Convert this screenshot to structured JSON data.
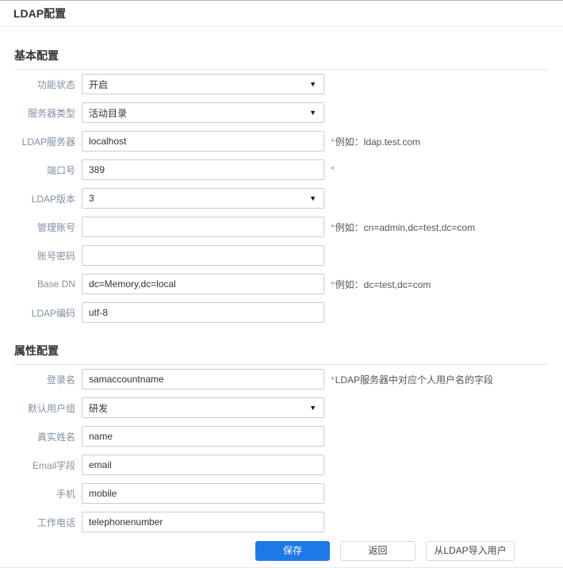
{
  "page": {
    "title": "LDAP配置"
  },
  "colors": {
    "accent_blue": "#1d79e8",
    "required_red": "#f56c6c",
    "label_gray_blue": "#8090a3",
    "border_gray": "#cccccc"
  },
  "icons": {
    "dropdown_arrow": "▼"
  },
  "sections": [
    {
      "title": "基本配置",
      "rows": [
        {
          "key": "function-status",
          "label": "功能状态",
          "type": "select",
          "value": "开启",
          "required": false,
          "hint": ""
        },
        {
          "key": "server-type",
          "label": "服务器类型",
          "type": "select",
          "value": "活动目录",
          "required": false,
          "hint": ""
        },
        {
          "key": "ldap-server",
          "label": "LDAP服务器",
          "type": "input",
          "value": "localhost",
          "required": true,
          "hint": "例如：ldap.test.com"
        },
        {
          "key": "port",
          "label": "端口号",
          "type": "input",
          "value": "389",
          "required": true,
          "hint": ""
        },
        {
          "key": "ldap-version",
          "label": "LDAP版本",
          "type": "select",
          "value": "3",
          "required": false,
          "hint": ""
        },
        {
          "key": "admin-account",
          "label": "管理账号",
          "type": "input",
          "value": "",
          "required": true,
          "hint": "例如：cn=admin,dc=test,dc=com"
        },
        {
          "key": "account-password",
          "label": "账号密码",
          "type": "input",
          "value": "",
          "required": false,
          "hint": ""
        },
        {
          "key": "base-dn",
          "label": "Base DN",
          "type": "input",
          "value": "dc=Memory,dc=local",
          "required": true,
          "hint": "例如：dc=test,dc=com"
        },
        {
          "key": "ldap-encoding",
          "label": "LDAP编码",
          "type": "input",
          "value": "utf-8",
          "required": false,
          "hint": ""
        }
      ]
    },
    {
      "title": "属性配置",
      "rows": [
        {
          "key": "login-name",
          "label": "登录名",
          "type": "input",
          "value": "samaccountname",
          "required": true,
          "hint": "LDAP服务器中对应个人用户名的字段"
        },
        {
          "key": "default-user-group",
          "label": "默认用户组",
          "type": "select",
          "value": "研发",
          "required": false,
          "hint": ""
        },
        {
          "key": "real-name",
          "label": "真实姓名",
          "type": "input",
          "value": "name",
          "required": false,
          "hint": ""
        },
        {
          "key": "email-field",
          "label": "Email字段",
          "type": "input",
          "value": "email",
          "required": false,
          "hint": ""
        },
        {
          "key": "mobile",
          "label": "手机",
          "type": "input",
          "value": "mobile",
          "required": false,
          "hint": ""
        },
        {
          "key": "work-phone",
          "label": "工作电话",
          "type": "input",
          "value": "telephonenumber",
          "required": false,
          "hint": ""
        }
      ]
    }
  ],
  "buttons": {
    "save": "保存",
    "back": "返回",
    "import": "从LDAP导入用户"
  }
}
